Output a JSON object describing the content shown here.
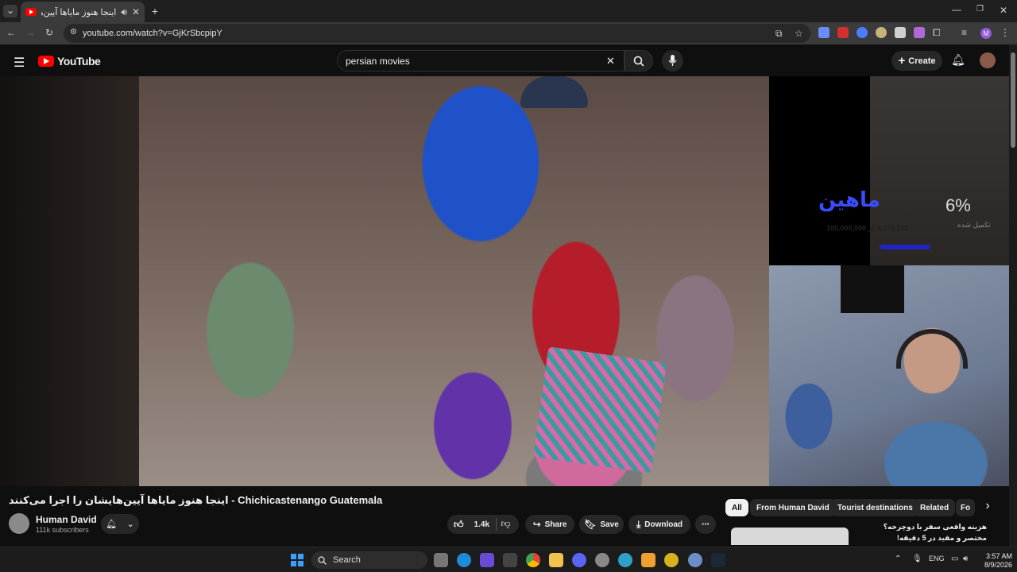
{
  "browser": {
    "tab_title": "اینجا هنوز مایاها آیین‌هایشان ,",
    "new_tab": "+",
    "url": "youtube.com/watch?v=GjKrSbcpipY",
    "profile_letter": "M"
  },
  "youtube": {
    "logo_text": "YouTube",
    "search_value": "persian movies",
    "create_label": "Create"
  },
  "video": {
    "title": "اینجا هنوز مایاها آیین‌هایشان را اجرا می‌کنند - Chichicastenango Guatemala",
    "overlay_percent": "6%",
    "overlay_sub": "تکمیل شده",
    "overlay_count": "6,243,222 از 100,000,000",
    "overlay_name": "ماهین"
  },
  "channel": {
    "name": "Human David",
    "subscribers": "111k subscribers"
  },
  "actions": {
    "likes": "1.4k",
    "share": "Share",
    "save": "Save",
    "download": "Download"
  },
  "chips": [
    "All",
    "From Human David",
    "Tourist destinations",
    "Related",
    "Fo"
  ],
  "suggestion": {
    "line1": "هزینه واقعی سفر با دوچرخه؟",
    "line2": "مختصر و مفید در 5 دقیقه!"
  },
  "taskbar": {
    "search_label": "Search",
    "lang": "ENG",
    "time": "3:57 AM",
    "date": "8/9/2026"
  },
  "colors": {
    "youtube_red": "#ff0000",
    "background": "#0f0f0f",
    "chip_active": "#f1f1f1"
  }
}
